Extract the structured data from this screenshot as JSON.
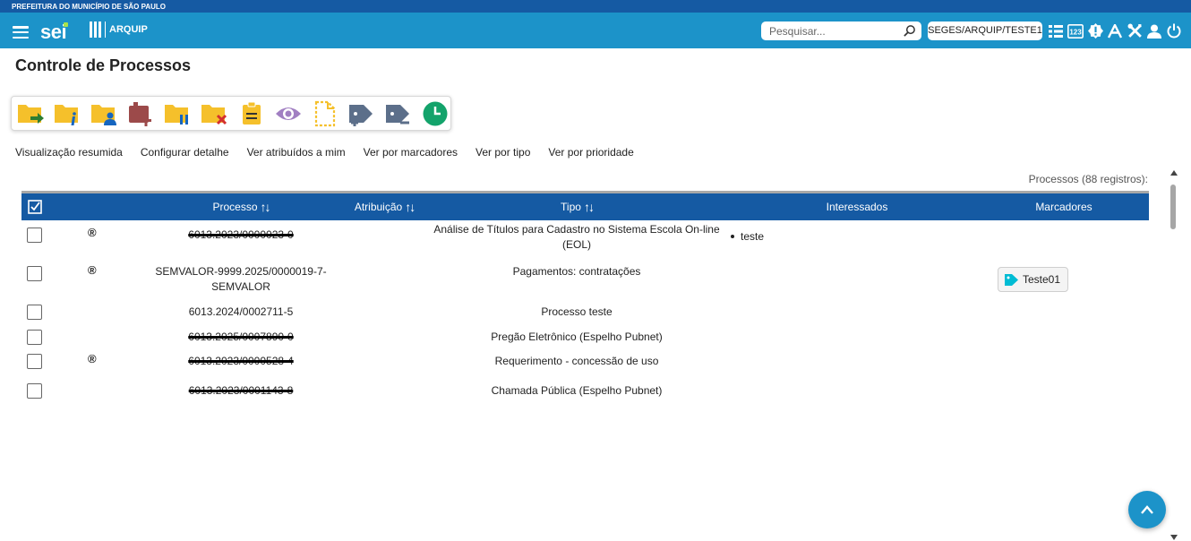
{
  "header": {
    "org_name": "PREFEITURA DO MUNICÍPIO DE SÃO PAULO",
    "logo_text": "sei",
    "logo_sub": "ARQUIP",
    "search_placeholder": "Pesquisar...",
    "unit_label": "SEGES/ARQUIP/TESTE1",
    "icons": [
      "list-icon",
      "numeric-icon",
      "alert-icon",
      "accessibility-icon",
      "tools-icon",
      "user-icon",
      "power-icon"
    ]
  },
  "page": {
    "title": "Controle de Processos"
  },
  "toolbar": {
    "icons": [
      "folder-send-icon",
      "folder-info-icon",
      "folder-user-icon",
      "folder-add-icon",
      "folder-pause-icon",
      "folder-close-icon",
      "clipboard-icon",
      "eye-icon",
      "document-dashed-icon",
      "tag-add-icon",
      "tag-remove-icon",
      "clock-icon"
    ]
  },
  "links": [
    "Visualização resumida",
    "Configurar detalhe",
    "Ver atribuídos a mim",
    "Ver por marcadores",
    "Ver por tipo",
    "Ver por prioridade"
  ],
  "count_label": "Processos (88 registros):",
  "table": {
    "headers": {
      "processo": "Processo",
      "atribuicao": "Atribuição",
      "tipo": "Tipo",
      "interessados": "Interessados",
      "marcadores": "Marcadores"
    },
    "rows": [
      {
        "reg": "®",
        "processo": "6013.2023/0000023-0",
        "tipo": "Análise de Títulos para Cadastro no Sistema Escola On-line (EOL)",
        "interessado": "teste",
        "marcador": ""
      },
      {
        "reg": "®",
        "processo": "SEMVALOR-9999.2025/0000019-7-SEMVALOR",
        "tipo": "Pagamentos: contratações",
        "interessado": "",
        "marcador": "Teste01"
      },
      {
        "reg": "",
        "processo": "6013.2024/0002711-5",
        "tipo": "Processo teste",
        "interessado": "",
        "marcador": ""
      },
      {
        "reg": "",
        "processo": "6013.2025/0007890-0",
        "tipo": "Pregão Eletrônico (Espelho Pubnet)",
        "interessado": "",
        "marcador": ""
      },
      {
        "reg": "®",
        "processo": "6013.2023/0000528-4",
        "tipo": "Requerimento - concessão de uso",
        "interessado": "",
        "marcador": ""
      },
      {
        "reg": "",
        "processo": "6013.2023/0001143-8",
        "tipo": "Chamada Pública (Espelho Pubnet)",
        "interessado": "",
        "marcador": ""
      }
    ]
  },
  "colors": {
    "navbar": "#1c93c9",
    "topstrip": "#155aa3",
    "table_header": "#155aa3",
    "folder": "#f5c02b",
    "tag": "#00bcd4"
  }
}
